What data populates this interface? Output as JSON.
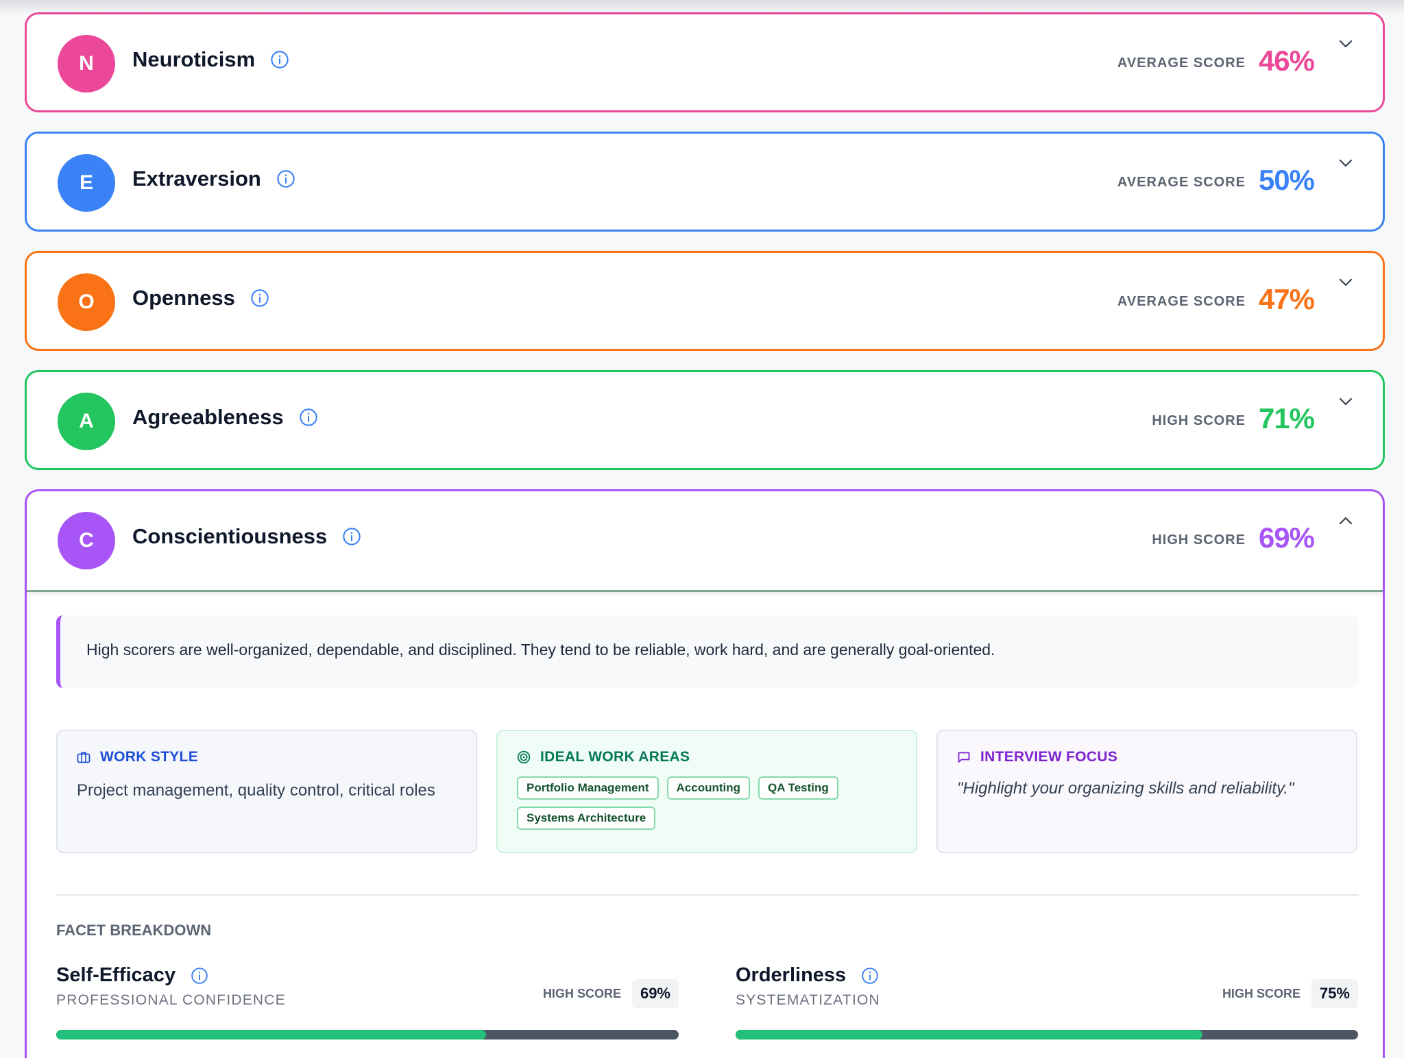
{
  "traits": [
    {
      "letter": "N",
      "name": "Neuroticism",
      "score_label": "AVERAGE SCORE",
      "score": "46%",
      "color": "#ec4899",
      "expanded": false
    },
    {
      "letter": "E",
      "name": "Extraversion",
      "score_label": "AVERAGE SCORE",
      "score": "50%",
      "color": "#3b82f6",
      "expanded": false
    },
    {
      "letter": "O",
      "name": "Openness",
      "score_label": "AVERAGE SCORE",
      "score": "47%",
      "color": "#f97316",
      "expanded": false
    },
    {
      "letter": "A",
      "name": "Agreeableness",
      "score_label": "HIGH SCORE",
      "score": "71%",
      "color": "#22c55e",
      "expanded": false
    },
    {
      "letter": "C",
      "name": "Conscientiousness",
      "score_label": "HIGH SCORE",
      "score": "69%",
      "color": "#a855f7",
      "expanded": true
    }
  ],
  "detail": {
    "description": "High scorers are well-organized, dependable, and disciplined. They tend to be reliable, work hard, and are generally goal-oriented.",
    "work_style": {
      "title": "WORK STYLE",
      "icon": "briefcase-icon",
      "text": "Project management, quality control, critical roles",
      "color": "#1d4ed8"
    },
    "ideal_work_areas": {
      "title": "IDEAL WORK AREAS",
      "icon": "target-icon",
      "tags": [
        "Portfolio Management",
        "Accounting",
        "QA Testing",
        "Systems Architecture"
      ],
      "color": "#047857"
    },
    "interview_focus": {
      "title": "INTERVIEW FOCUS",
      "icon": "message-icon",
      "text": "\"Highlight your organizing skills and reliability.\"",
      "color": "#7e22ce"
    },
    "facet_heading": "FACET BREAKDOWN",
    "facets": [
      {
        "name": "Self-Efficacy",
        "subtitle": "PROFESSIONAL CONFIDENCE",
        "score_label": "HIGH SCORE",
        "score": "69%",
        "progress": 0.69
      },
      {
        "name": "Orderliness",
        "subtitle": "SYSTEMATIZATION",
        "score_label": "HIGH SCORE",
        "score": "75%",
        "progress": 0.75
      }
    ]
  }
}
